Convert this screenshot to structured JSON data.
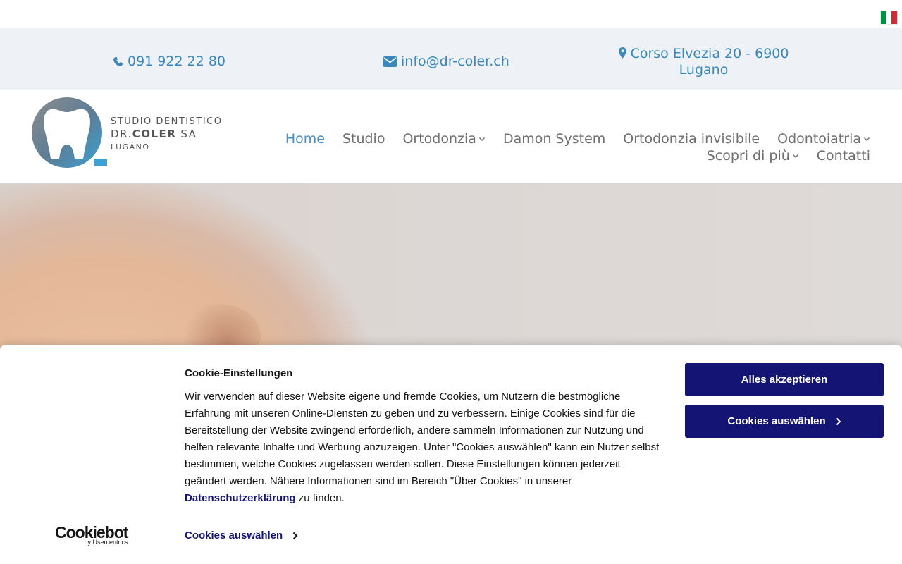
{
  "contact": {
    "phone": "091 922 22 80",
    "email": "info@dr-coler.ch",
    "address_line1": "Corso Elvezia 20 - 6900",
    "address_line2": "Lugano"
  },
  "logo": {
    "line1": "STUDIO DENTISTICO",
    "line2_prefix": "DR.",
    "line2_bold": "COLER",
    "line2_suffix": "SA",
    "line3": "LUGANO"
  },
  "nav": {
    "row1": [
      {
        "label": "Home",
        "active": true,
        "dropdown": false
      },
      {
        "label": "Studio",
        "active": false,
        "dropdown": false
      },
      {
        "label": "Ortodonzia",
        "active": false,
        "dropdown": true
      },
      {
        "label": "Damon System",
        "active": false,
        "dropdown": false
      },
      {
        "label": "Ortodonzia invisibile",
        "active": false,
        "dropdown": false
      },
      {
        "label": "Odontoiatria",
        "active": false,
        "dropdown": true
      }
    ],
    "row2": [
      {
        "label": "Scopri di più",
        "active": false,
        "dropdown": true
      },
      {
        "label": "Contatti",
        "active": false,
        "dropdown": false
      }
    ]
  },
  "cookie": {
    "title": "Cookie-Einstellungen",
    "body_before": "Wir verwenden auf dieser Website eigene und fremde Cookies, um Nutzern die bestmögliche Erfahrung mit unseren Online-Diensten zu geben und zu verbessern. Einige Cookies sind für die Bereitstellung der Website zwingend erforderlich, andere sammeln Informationen zur Nutzung und helfen relevante Inhalte und Werbung anzuzeigen. Unter \"Cookies auswählen\" kann ein Nutzer selbst bestimmen, welche Cookies zugelassen werden sollen. Diese Einstellungen können jederzeit geändert werden. Nähere Informationen sind im Bereich \"Über Cookies\" in unserer ",
    "body_link": "Datenschutzerklärung",
    "body_after": " zu finden.",
    "accept_all": "Alles akzeptieren",
    "select_cookies": "Cookies auswählen",
    "select_link": "Cookies auswählen",
    "brand": "Cookiebot",
    "brand_sub": "by Usercentrics"
  },
  "colors": {
    "accent": "#3a87b9",
    "nav_text": "#6f6f6f",
    "cookie_button": "#141475"
  }
}
